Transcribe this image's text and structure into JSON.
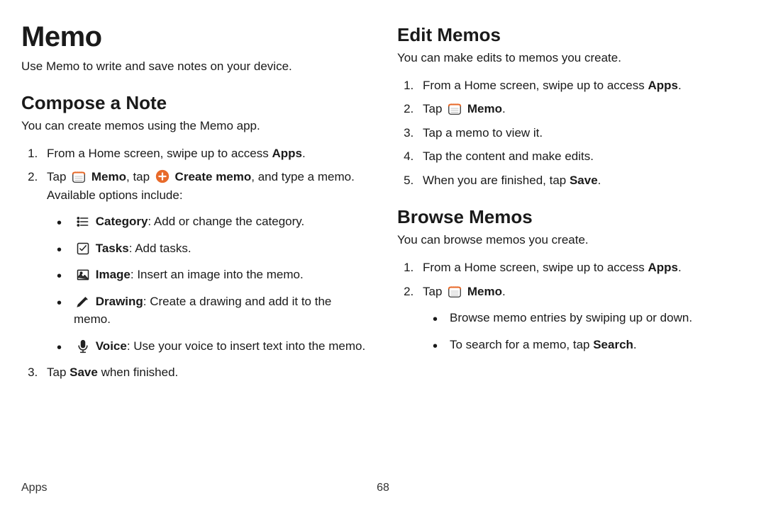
{
  "title": "Memo",
  "intro": "Use Memo to write and save notes on your device.",
  "compose": {
    "heading": "Compose a Note",
    "lead": "You can create memos using the Memo app.",
    "step1_a": "From a Home screen, swipe up to access ",
    "apps": "Apps",
    "step1_b": ".",
    "step2_a": "Tap ",
    "memo": "Memo",
    "step2_b": ", tap ",
    "create": "Create memo",
    "step2_c": ", and type a memo. Available options include:",
    "opt_category_t": "Category",
    "opt_category_d": ": Add or change the category.",
    "opt_tasks_t": "Tasks",
    "opt_tasks_d": ": Add tasks.",
    "opt_image_t": "Image",
    "opt_image_d": ": Insert an image into the memo.",
    "opt_drawing_t": "Drawing",
    "opt_drawing_d": ": Create a drawing and add it to the memo.",
    "opt_voice_t": "Voice",
    "opt_voice_d": ": Use your voice to insert text into the memo.",
    "step3_a": "Tap ",
    "save": "Save",
    "step3_b": " when finished."
  },
  "edit": {
    "heading": "Edit Memos",
    "lead": "You can make edits to memos you create.",
    "s1a": "From a Home screen, swipe up to access ",
    "apps": "Apps",
    "s1b": ".",
    "s2a": "Tap ",
    "memo": "Memo",
    "s2b": ".",
    "s3": "Tap a memo to view it.",
    "s4": "Tap the content and make edits.",
    "s5a": "When you are finished, tap ",
    "save": "Save",
    "s5b": "."
  },
  "browse": {
    "heading": "Browse Memos",
    "lead": "You can browse memos you create.",
    "s1a": "From a Home screen, swipe up to access ",
    "apps": "Apps",
    "s1b": ".",
    "s2a": "Tap ",
    "memo": "Memo",
    "s2b": ".",
    "b1": "Browse memo entries by swiping up or down.",
    "b2a": "To search for a memo, tap ",
    "search": "Search",
    "b2b": "."
  },
  "footer": {
    "section": "Apps",
    "page": "68"
  }
}
